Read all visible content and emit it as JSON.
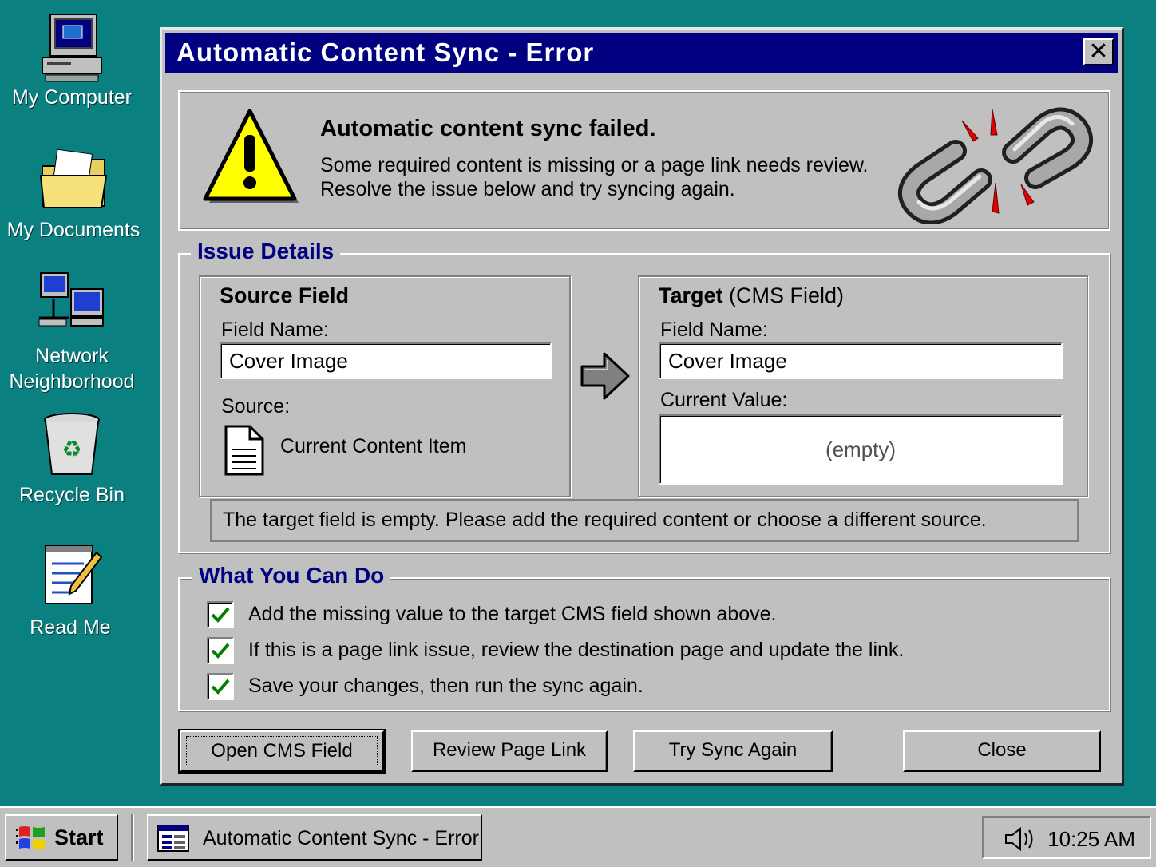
{
  "desktop": {
    "icons": [
      {
        "label": "My Computer",
        "icon": "computer-icon"
      },
      {
        "label": "My Documents",
        "icon": "folder-icon"
      },
      {
        "label": "Network Neighborhood",
        "icon": "network-icon"
      },
      {
        "label": "Recycle Bin",
        "icon": "recycle-bin-icon"
      },
      {
        "label": "Read Me",
        "icon": "notepad-icon"
      }
    ]
  },
  "window": {
    "title": "Automatic Content Sync - Error",
    "close_label": "✕",
    "error": {
      "headline": "Automatic content sync failed.",
      "line1": "Some required content is missing or a page link needs review.",
      "line2": "Resolve the issue below and try syncing again."
    },
    "issue_details": {
      "legend": "Issue Details",
      "source": {
        "heading": "Source Field",
        "field_name_label": "Field Name:",
        "field_name_value": "Cover Image",
        "source_label": "Source:",
        "source_value": "Current Content Item"
      },
      "target": {
        "heading": "Target",
        "heading_sub": "(CMS Field)",
        "field_name_label": "Field Name:",
        "field_name_value": "Cover Image",
        "current_value_label": "Current Value:",
        "current_value": "(empty)"
      },
      "message": "The target field is empty. Please add the required content or choose a different source."
    },
    "what_you_can_do": {
      "legend": "What You Can Do",
      "items": [
        {
          "text": "Add the missing value to the target CMS field shown above.",
          "checked": true
        },
        {
          "text": "If this is a page link issue, review the destination page and update the link.",
          "checked": true
        },
        {
          "text": "Save your changes, then run the sync again.",
          "checked": true
        }
      ]
    },
    "buttons": {
      "open_cms_field": "Open CMS Field",
      "review_page_link": "Review Page Link",
      "try_sync_again": "Try Sync Again",
      "close": "Close"
    }
  },
  "taskbar": {
    "start_label": "Start",
    "task_label": "Automatic Content Sync - Error",
    "clock": "10:25 AM"
  },
  "colors": {
    "desktop": "#0b8080",
    "titlebar": "#000080",
    "face": "#c0c0c0",
    "check": "#008000"
  }
}
